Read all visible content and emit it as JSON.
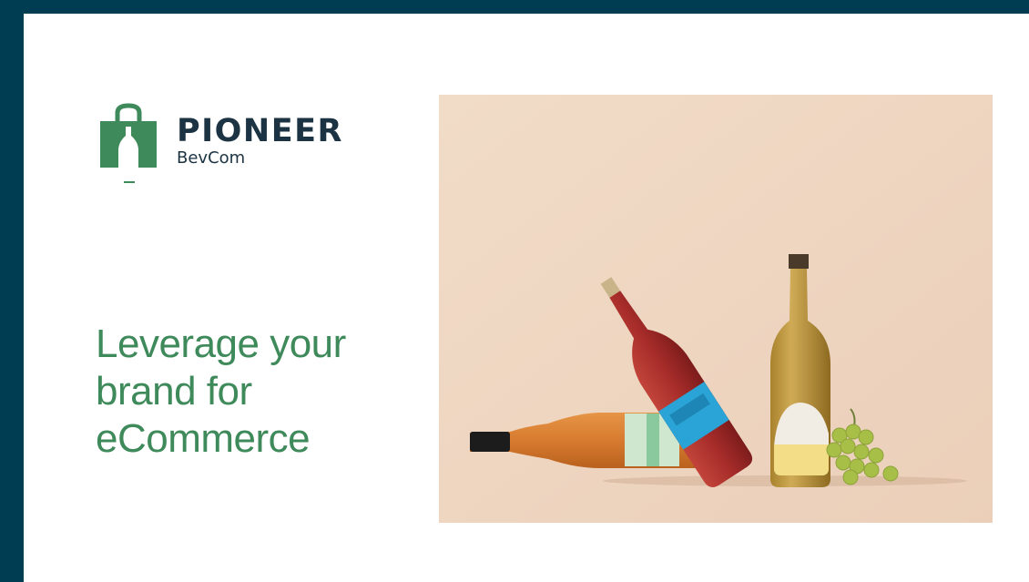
{
  "logo": {
    "name": "PIONEER",
    "sub": "BevCom",
    "icon": "shopping-bag-bottle-icon",
    "color": "#3f8a5b"
  },
  "headline": {
    "line1": "Leverage your",
    "line2": "brand for",
    "line3": "eCommerce",
    "color": "#3f8a5b"
  },
  "photo": {
    "subject": "wine-bottles-and-grapes",
    "background_color": "#efd5c0"
  },
  "frame": {
    "color": "#003d52"
  }
}
